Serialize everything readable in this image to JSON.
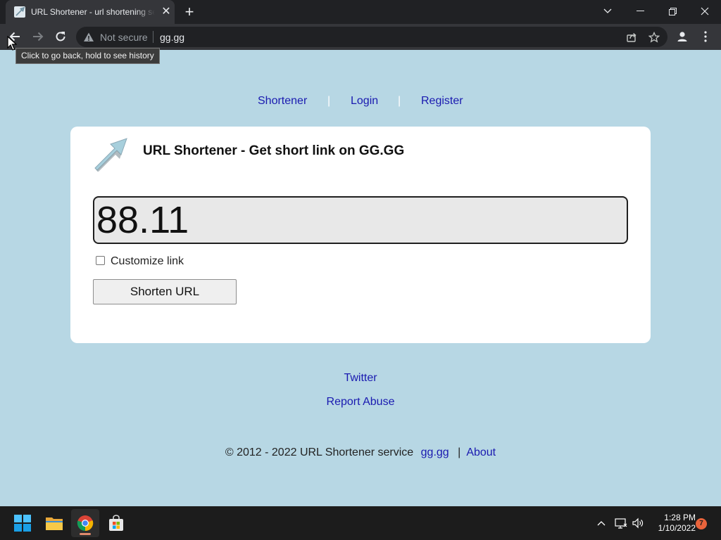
{
  "browser": {
    "tab_title": "URL Shortener - url shortening service",
    "tab_close": "✕",
    "new_tab": "+",
    "security_label": "Not secure",
    "url": "gg.gg",
    "tooltip": "Click to go back, hold to see history"
  },
  "nav": {
    "items": [
      "Shortener",
      "Login",
      "Register"
    ],
    "separator": "|"
  },
  "card": {
    "title": "URL Shortener - Get short link on GG.GG",
    "url_input_value": "88.11",
    "customize_label": "Customize link",
    "customize_checked": false,
    "shorten_button": "Shorten URL"
  },
  "footer": {
    "links": [
      "Twitter",
      "Report Abuse"
    ],
    "copyright": "© 2012 - 2022 URL Shortener service",
    "site_link": "gg.gg",
    "separator": "|",
    "about_link": "About"
  },
  "taskbar": {
    "apps": [
      "start-icon",
      "file-explorer-icon",
      "chrome-icon",
      "store-icon"
    ],
    "time": "1:28 PM",
    "date": "1/10/2022",
    "notification_count": "7"
  },
  "colors": {
    "page_background": "#b7d7e4",
    "link": "#1a1ab0",
    "card": "#ffffff",
    "chrome_dark": "#202124",
    "taskbar": "#1c1c1c"
  }
}
